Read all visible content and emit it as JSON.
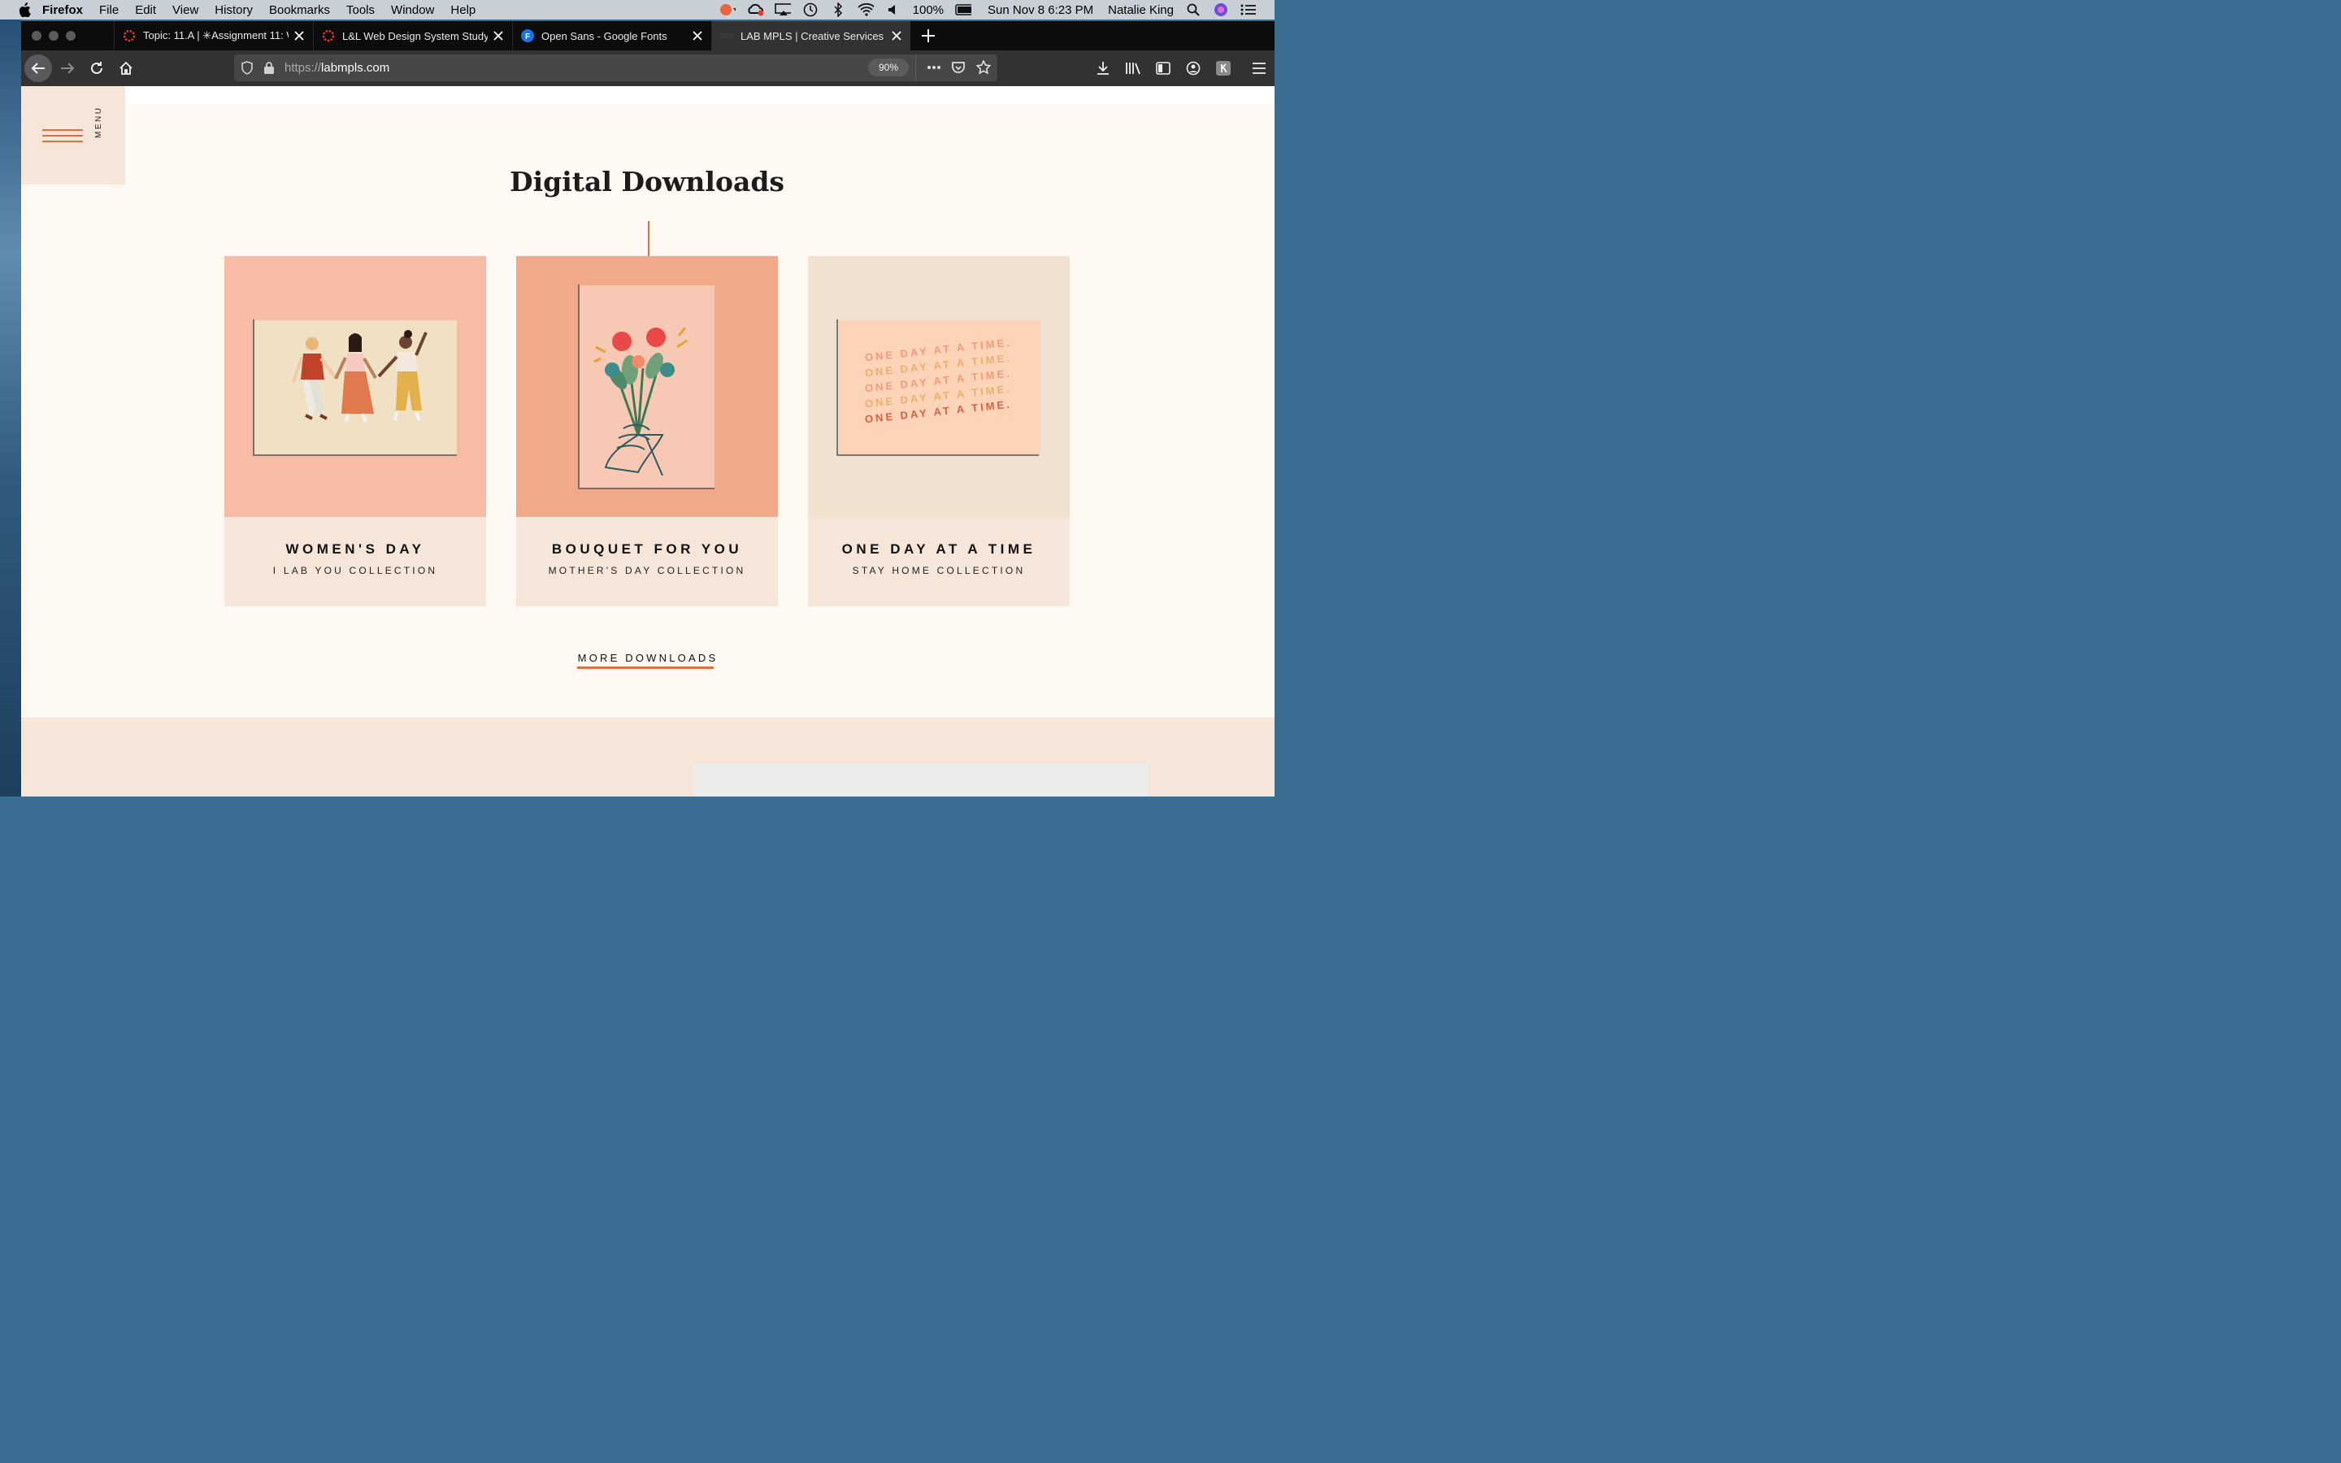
{
  "os_menubar": {
    "app_name": "Firefox",
    "menus": [
      "File",
      "Edit",
      "View",
      "History",
      "Bookmarks",
      "Tools",
      "Window",
      "Help"
    ],
    "battery": "100%",
    "datetime": "Sun Nov 8  6:23 PM",
    "user": "Natalie King"
  },
  "tabs": [
    {
      "title": "Topic: 11.A | ✳Assignment 11: W",
      "icon": "canvas-icon"
    },
    {
      "title": "L&L Web Design System Study",
      "icon": "canvas-icon"
    },
    {
      "title": "Open Sans - Google Fonts",
      "icon": "google-fonts-icon"
    },
    {
      "title": "LAB MPLS | Creative Services |",
      "icon": "lab-icon"
    }
  ],
  "address": {
    "scheme": "https://",
    "host": "labmpls.com",
    "zoom": "90%"
  },
  "site": {
    "menu_label": "MENU",
    "section_title": "Digital Downloads",
    "cards": [
      {
        "title": "WOMEN'S DAY",
        "subtitle": "I LAB YOU COLLECTION",
        "bg": "#f8bba6",
        "card_bg": "#f1e1c4"
      },
      {
        "title": "BOUQUET FOR YOU",
        "subtitle": "MOTHER'S DAY COLLECTION",
        "bg": "#f2a88a",
        "card_bg": "#f7c9b4"
      },
      {
        "title": "ONE DAY AT A TIME",
        "subtitle": "STAY HOME COLLECTION",
        "bg": "#f1e1d0",
        "card_bg": "#fdd4b8"
      }
    ],
    "card3_phrase": "ONE DAY AT A TIME.",
    "more_link": "MORE DOWNLOADS",
    "accent": "#e0703f"
  }
}
